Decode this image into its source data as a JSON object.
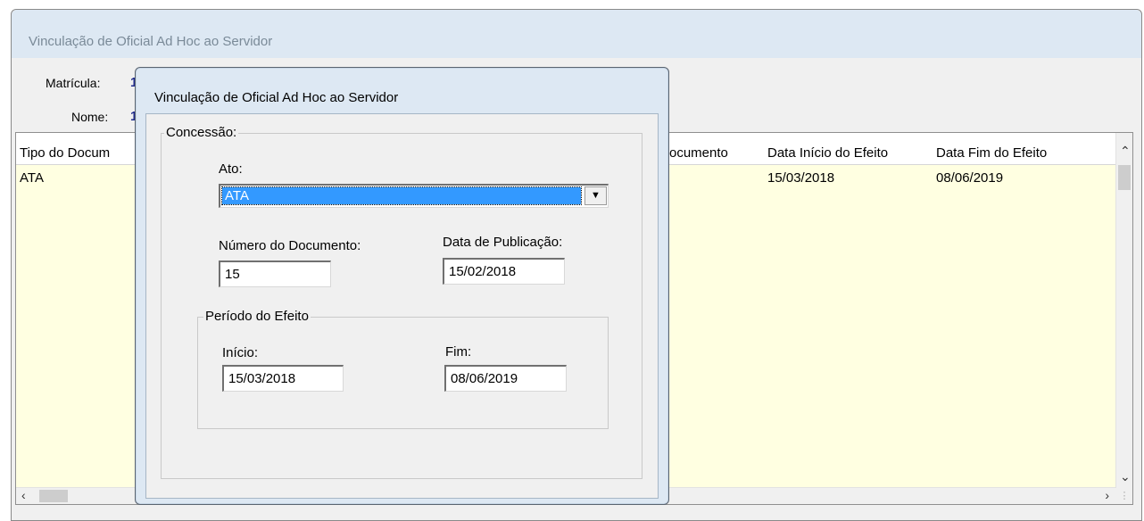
{
  "main_window": {
    "title": "Vinculação de Oficial Ad Hoc ao Servidor",
    "matricula_label": "Matrícula:",
    "matricula_value": "1",
    "nome_label": "Nome:",
    "nome_value": "1"
  },
  "grid": {
    "columns": [
      "Tipo do Docum",
      "ocumento",
      "Data Início do Efeito",
      "Data Fim do Efeito"
    ],
    "row": {
      "tipo": "ATA",
      "inicio": "15/03/2018",
      "fim": "08/06/2019"
    },
    "icons": {
      "scroll_up": "chevron-up-icon",
      "scroll_down": "chevron-down-icon",
      "scroll_left": "chevron-left-icon",
      "scroll_right": "chevron-right-icon",
      "grip": "size-grip-icon"
    }
  },
  "dialog": {
    "title": "Vinculação de Oficial Ad Hoc ao Servidor",
    "concessao_legend": "Concessão:",
    "ato_label": "Ato:",
    "ato_value": "ATA",
    "numero_label": "Número do Documento:",
    "numero_value": "15",
    "data_pub_label": "Data de Publicação:",
    "data_pub_value": "15/02/2018",
    "periodo_legend": "Período do Efeito",
    "inicio_label": "Início:",
    "inicio_value": "15/03/2018",
    "fim_label": "Fim:",
    "fim_value": "08/06/2019"
  },
  "colors": {
    "selection": "#3399ff",
    "grid_bg": "#ffffe1",
    "value_text": "#1f2b8c"
  }
}
